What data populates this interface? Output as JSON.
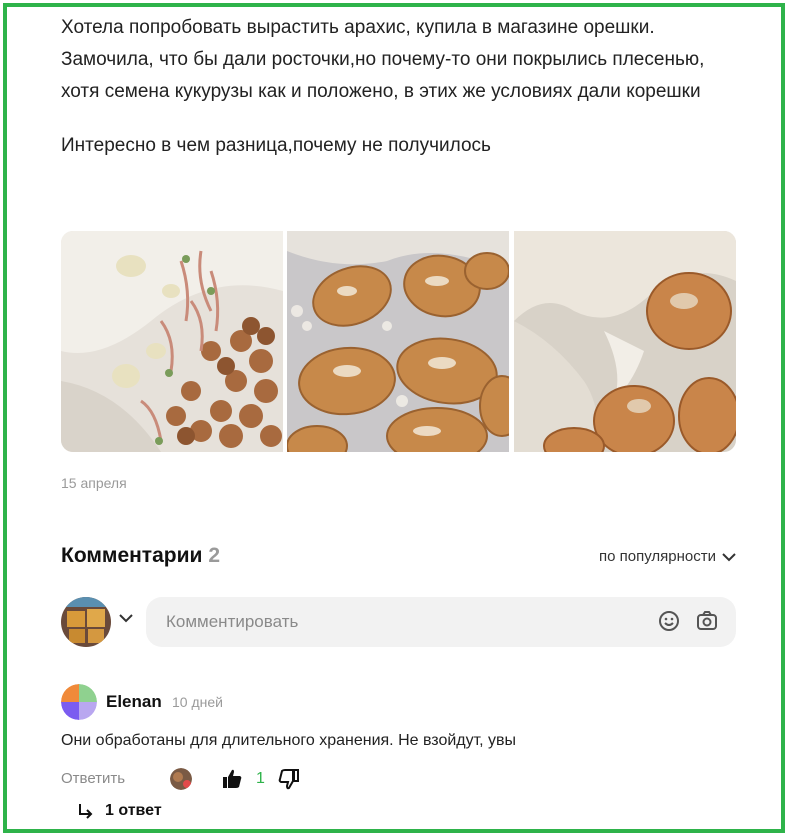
{
  "post": {
    "paragraph1": "Хотела попробовать вырастить арахис, купила в магазине орешки. Замочила, что бы дали росточки,но почему-то они покрылись плесенью, хотя семена кукурузы как и положено, в этих же условиях дали корешки",
    "paragraph2": "Интересно в чем разница,почему не получилось",
    "date": "15 апреля",
    "photos": [
      "photo-sprouted-mix",
      "photo-moldy-peanuts",
      "photo-moldy-peanuts-closeup"
    ]
  },
  "comments": {
    "title": "Комментарии",
    "count": "2",
    "sort_label": "по популярности",
    "input_placeholder": "Комментировать",
    "items": [
      {
        "author": "Elenan",
        "time": "10 дней",
        "text": "Они обработаны для длительного хранения. Не взойдут, увы",
        "reply_label": "Ответить",
        "likes": "1",
        "replies_label": "1 ответ"
      }
    ]
  },
  "colors": {
    "frame": "#2eb34a",
    "like_count": "#2eb34a",
    "muted": "#9a9a9a",
    "input_bg": "#f2f2f2"
  },
  "icons": [
    "chevron-down-icon",
    "emoji-icon",
    "camera-icon",
    "thumbs-up-icon",
    "thumbs-down-icon",
    "reply-arrow-icon"
  ]
}
